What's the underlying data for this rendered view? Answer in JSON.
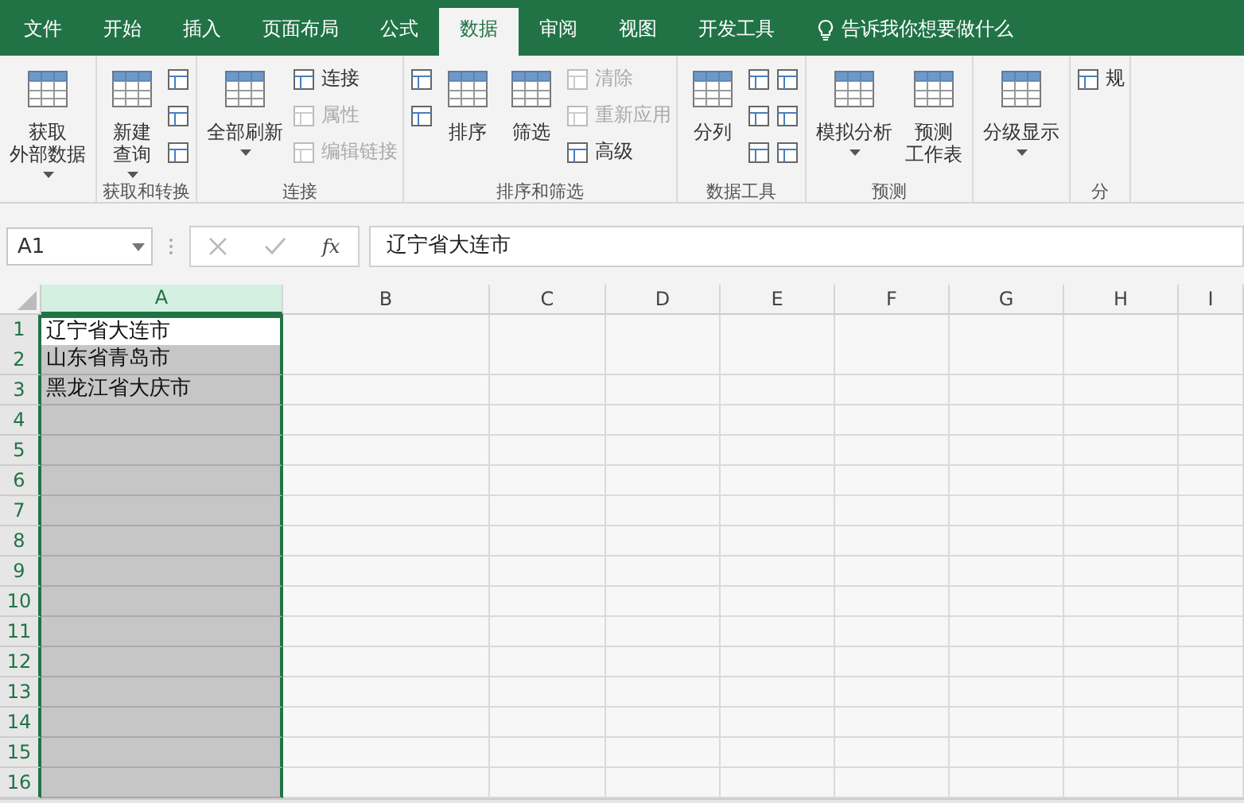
{
  "tabs": [
    {
      "label": "文件",
      "selected": false
    },
    {
      "label": "开始",
      "selected": false
    },
    {
      "label": "插入",
      "selected": false
    },
    {
      "label": "页面布局",
      "selected": false
    },
    {
      "label": "公式",
      "selected": false
    },
    {
      "label": "数据",
      "selected": true
    },
    {
      "label": "审阅",
      "selected": false
    },
    {
      "label": "视图",
      "selected": false
    },
    {
      "label": "开发工具",
      "selected": false
    }
  ],
  "tell_me": "告诉我你想要做什么",
  "ribbon_groups": [
    {
      "items": [
        {
          "kind": "large",
          "lines": [
            "获取",
            "外部数据"
          ],
          "dropdown": true
        }
      ]
    },
    {
      "label": "获取和转换",
      "items": [
        {
          "kind": "large",
          "lines": [
            "新建",
            "查询"
          ],
          "dropdown": true
        },
        {
          "kind": "stack",
          "buttons": [
            {
              "kind": "icon"
            },
            {
              "kind": "icon"
            },
            {
              "kind": "icon"
            }
          ]
        }
      ]
    },
    {
      "label": "连接",
      "items": [
        {
          "kind": "large",
          "lines": [
            "全部刷新"
          ],
          "dropdown": true
        },
        {
          "kind": "stack",
          "buttons": [
            {
              "label": "连接",
              "disabled": false
            },
            {
              "label": "属性",
              "disabled": true
            },
            {
              "label": "编辑链接",
              "disabled": true
            }
          ]
        }
      ]
    },
    {
      "label": "排序和筛选",
      "items": [
        {
          "kind": "stack",
          "buttons": [
            {
              "kind": "icon"
            },
            {
              "kind": "icon"
            }
          ]
        },
        {
          "kind": "large",
          "lines": [
            "排序"
          ],
          "dropdown": false
        },
        {
          "kind": "large",
          "lines": [
            "筛选"
          ],
          "dropdown": false
        },
        {
          "kind": "stack",
          "buttons": [
            {
              "label": "清除",
              "disabled": true
            },
            {
              "label": "重新应用",
              "disabled": true
            },
            {
              "label": "高级",
              "disabled": false
            }
          ]
        }
      ]
    },
    {
      "label": "数据工具",
      "items": [
        {
          "kind": "large",
          "lines": [
            "分列"
          ],
          "dropdown": false
        },
        {
          "kind": "stack",
          "buttons": [
            {
              "kind": "icon"
            },
            {
              "kind": "icon"
            },
            {
              "kind": "icon"
            }
          ]
        },
        {
          "kind": "stack",
          "buttons": [
            {
              "kind": "icon"
            },
            {
              "kind": "icon"
            },
            {
              "kind": "icon"
            }
          ]
        }
      ]
    },
    {
      "label": "预测",
      "items": [
        {
          "kind": "large",
          "lines": [
            "模拟分析"
          ],
          "dropdown": true
        },
        {
          "kind": "large",
          "lines": [
            "预测",
            "工作表"
          ],
          "dropdown": false
        }
      ]
    },
    {
      "items": [
        {
          "kind": "large",
          "lines": [
            "分级显示"
          ],
          "dropdown": true
        }
      ]
    },
    {
      "label": "分",
      "items": [
        {
          "kind": "stack",
          "buttons": [
            {
              "label": "规"
            }
          ]
        }
      ]
    }
  ],
  "formula_bar": {
    "name_box": "A1",
    "function_label": "fx",
    "content": "辽宁省大连市"
  },
  "sheet": {
    "columns": [
      {
        "label": "A",
        "selected": true
      },
      {
        "label": "B",
        "selected": false
      },
      {
        "label": "C",
        "selected": false
      },
      {
        "label": "D",
        "selected": false
      },
      {
        "label": "E",
        "selected": false
      },
      {
        "label": "F",
        "selected": false
      },
      {
        "label": "G",
        "selected": false
      },
      {
        "label": "H",
        "selected": false
      },
      {
        "label": "I",
        "selected": false
      }
    ],
    "rows": [
      {
        "number": "1",
        "cells": [
          "辽宁省大连市"
        ]
      },
      {
        "number": "2",
        "cells": [
          "山东省青岛市"
        ]
      },
      {
        "number": "3",
        "cells": [
          "黑龙江省大庆市"
        ]
      },
      {
        "number": "4"
      },
      {
        "number": "5"
      },
      {
        "number": "6"
      },
      {
        "number": "7"
      },
      {
        "number": "8"
      },
      {
        "number": "9"
      },
      {
        "number": "10"
      },
      {
        "number": "11"
      },
      {
        "number": "12"
      },
      {
        "number": "13"
      },
      {
        "number": "14"
      },
      {
        "number": "15"
      },
      {
        "number": "16"
      }
    ]
  }
}
